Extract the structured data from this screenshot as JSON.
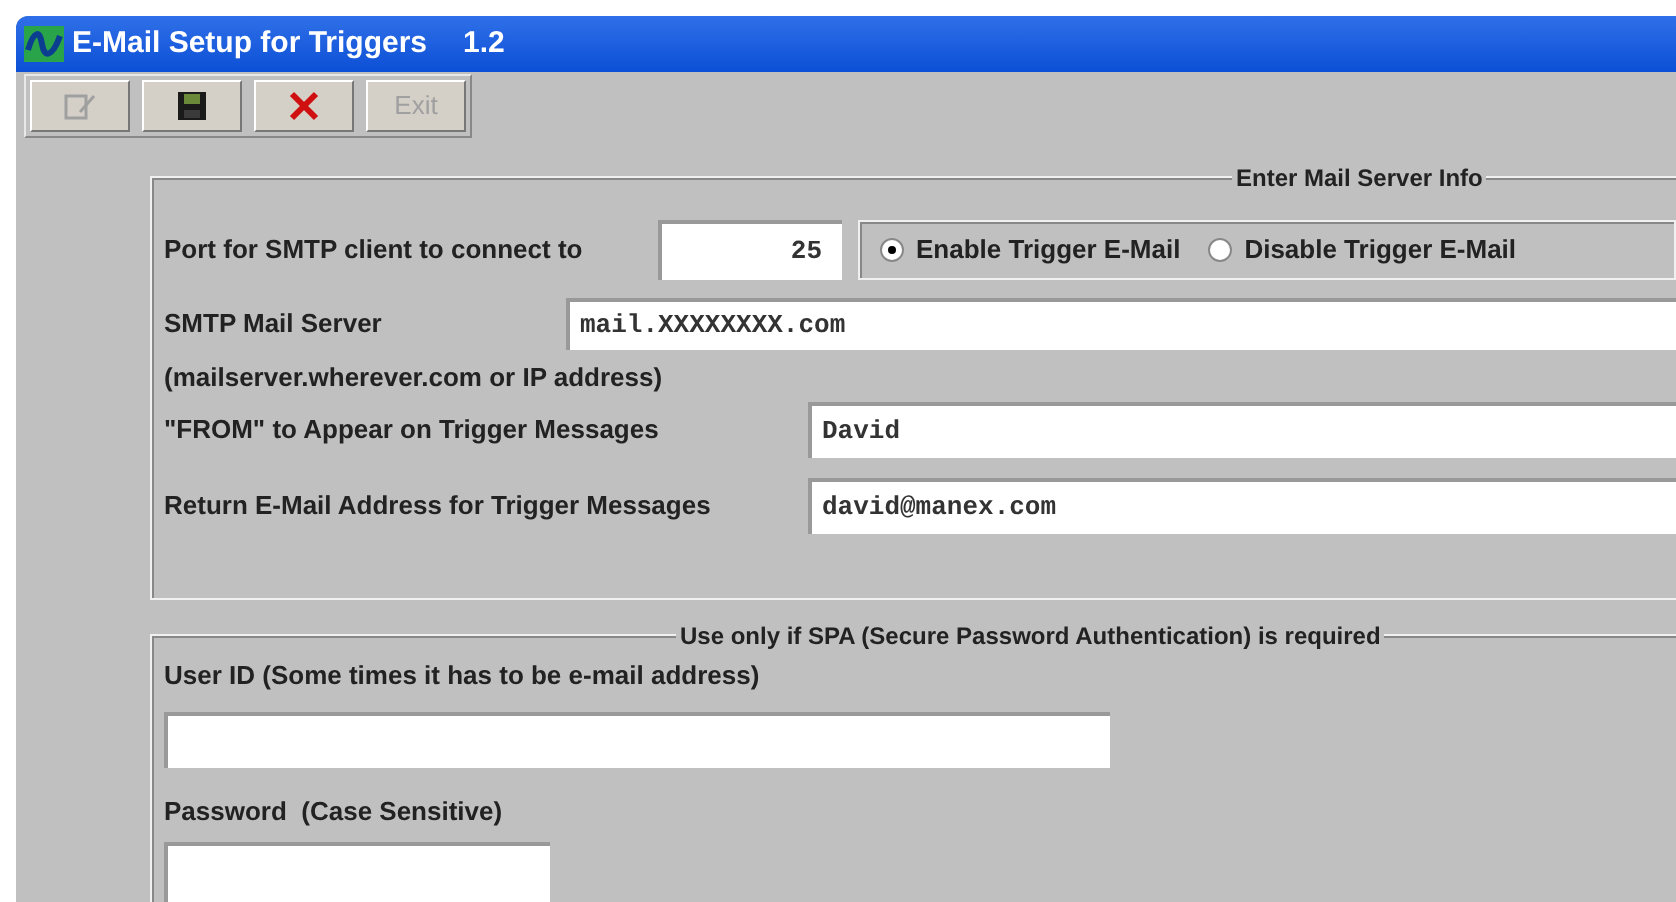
{
  "window": {
    "title": "E-Mail Setup for Triggers",
    "version": "1.2"
  },
  "toolbar": [
    {
      "kind": "edit",
      "disabled": true
    },
    {
      "kind": "save",
      "disabled": false
    },
    {
      "kind": "delete",
      "disabled": false
    },
    {
      "kind": "text",
      "label": "Exit",
      "disabled": true
    }
  ],
  "mail_server": {
    "legend": "Enter Mail Server Info",
    "port": {
      "label": "Port for SMTP client to connect to",
      "value": "25"
    },
    "trigger_options": [
      {
        "label": "Enable Trigger E-Mail",
        "selected": true
      },
      {
        "label": "Disable Trigger E-Mail",
        "selected": false
      }
    ],
    "smtp_server": {
      "label": "SMTP Mail Server",
      "value": "mail.XXXXXXXX.com",
      "hint": "(mailserver.wherever.com or IP address)"
    },
    "from": {
      "label": "\"FROM\" to Appear on Trigger Messages",
      "value": "David"
    },
    "return_address": {
      "label": "Return E-Mail Address for Trigger Messages",
      "value": "david@manex.com"
    }
  },
  "spa": {
    "legend": "Use only if SPA (Secure Password Authentication) is required",
    "user_id": {
      "label": "User ID (Some times it has to be e-mail address)"
    },
    "password": {
      "label": "Password  (Case Sensitive)"
    }
  }
}
